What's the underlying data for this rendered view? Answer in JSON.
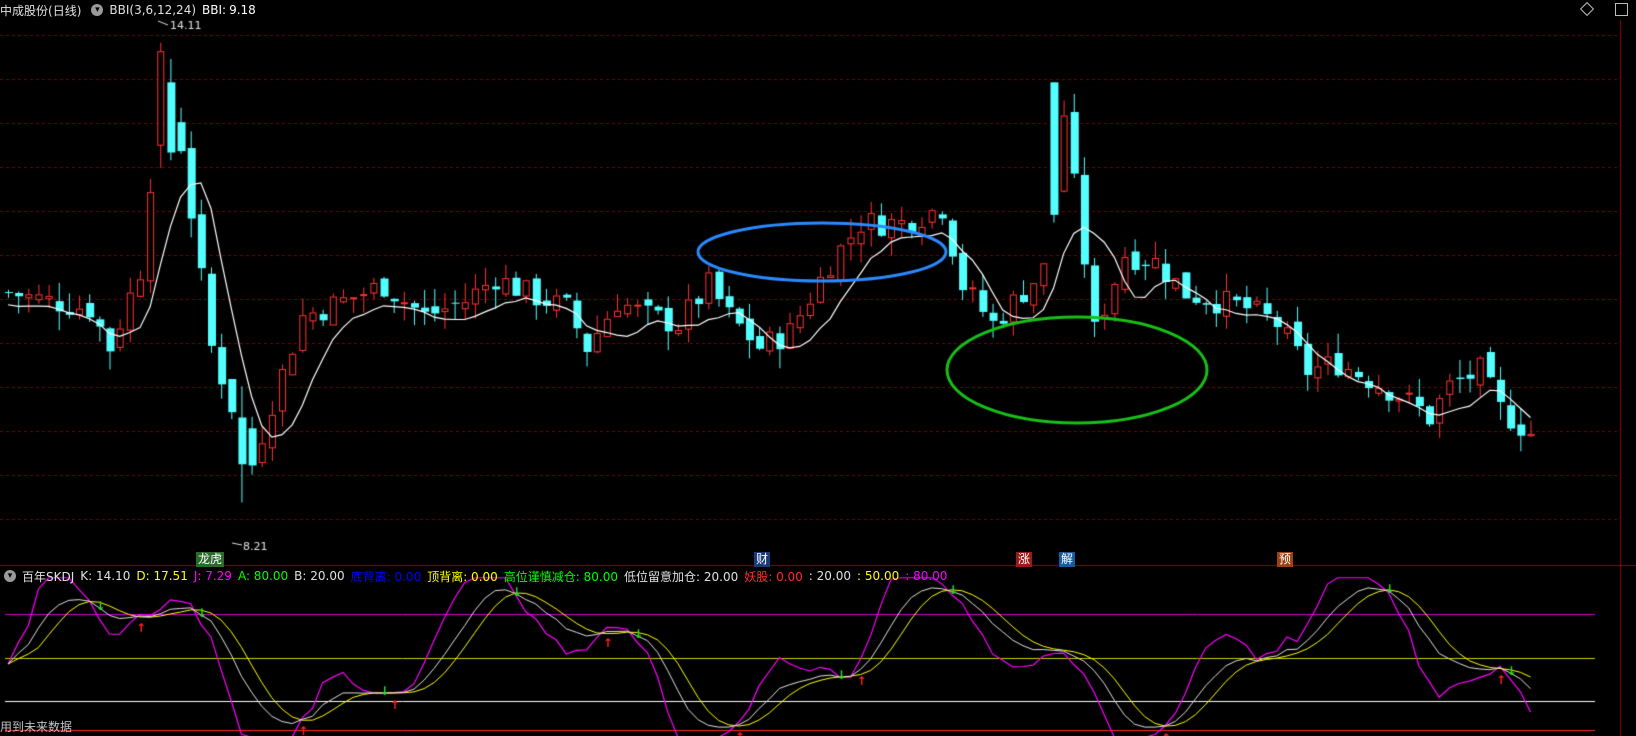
{
  "main_panel": {
    "stock_name": "中成股份",
    "period": "(日线)",
    "indicator": "BBI(3,6,12,24)",
    "bbi_label": "BBI:",
    "bbi_value": "9.18",
    "high_label": "14.11",
    "low_label": "8.21"
  },
  "event_markers": [
    {
      "text": "龙虎",
      "color": "#ffffff",
      "bg": "#2a6a2a"
    },
    {
      "text": "财",
      "color": "#ffffff",
      "bg": "#1a3a7a"
    },
    {
      "text": "涨",
      "color": "#ffffff",
      "bg": "#9a1a1a"
    },
    {
      "text": "解",
      "color": "#ffffff",
      "bg": "#1a5a9a"
    },
    {
      "text": "预",
      "color": "#ffffff",
      "bg": "#a04010"
    }
  ],
  "sub_panel": {
    "name": "百年SKDJ",
    "fields": [
      {
        "label": "K:",
        "value": "14.10",
        "color": "#e0e0e0"
      },
      {
        "label": "D:",
        "value": "17.51",
        "color": "#ffff00"
      },
      {
        "label": "J:",
        "value": "7.29",
        "color": "#ff00ff"
      },
      {
        "label": "A:",
        "value": "80.00",
        "color": "#00ff00"
      },
      {
        "label": "B:",
        "value": "20.00",
        "color": "#e0e0e0"
      },
      {
        "label": "底背离:",
        "value": "0.00",
        "color": "#0000ff"
      },
      {
        "label": "顶背离:",
        "value": "0.00",
        "color": "#ffff00"
      },
      {
        "label": "高位谨慎减仓:",
        "value": "80.00",
        "color": "#00ff00"
      },
      {
        "label": "低位留意加仓:",
        "value": "20.00",
        "color": "#e0e0e0"
      },
      {
        "label": "妖股:",
        "value": "0.00",
        "color": "#ff2a2a"
      },
      {
        "label": ":",
        "value": "20.00",
        "color": "#e0e0e0"
      },
      {
        "label": ":",
        "value": "50.00",
        "color": "#ffff00"
      },
      {
        "label": ":",
        "value": "80.00",
        "color": "#ff00ff"
      }
    ]
  },
  "footer_text": "用到未来数据",
  "colors": {
    "up_candle": "#ff3232",
    "down_candle": "#54ffff",
    "bbi_line": "#ffffff",
    "grid": "#7a0000",
    "ellipse_top": "#2a8aff",
    "ellipse_bottom": "#18c018",
    "line_80": "#cc00cc",
    "line_50": "#cccc00",
    "line_20": "#ffffff",
    "k_line": "#e0e0e0",
    "d_line": "#ffff00",
    "j_line": "#ff00ff"
  },
  "price_range": [
    7.6,
    14.4
  ]
}
